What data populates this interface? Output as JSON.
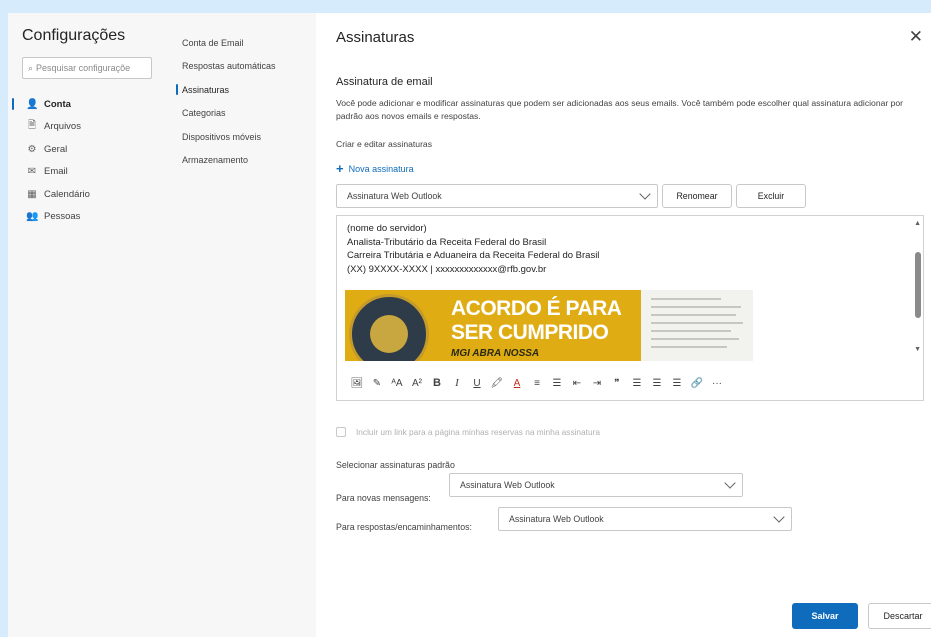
{
  "app": {
    "title": "Configurações"
  },
  "search": {
    "placeholder": "Pesquisar configuraçõe"
  },
  "nav": [
    {
      "label": "Conta",
      "icon": "person-icon",
      "active": true
    },
    {
      "label": "Arquivos",
      "icon": "document-icon",
      "active": false
    },
    {
      "label": "Geral",
      "icon": "gear-icon",
      "active": false
    },
    {
      "label": "Email",
      "icon": "mail-icon",
      "active": false
    },
    {
      "label": "Calendário",
      "icon": "calendar-icon",
      "active": false
    },
    {
      "label": "Pessoas",
      "icon": "people-icon",
      "active": false
    }
  ],
  "subnav": [
    {
      "label": "Conta de Email",
      "active": false
    },
    {
      "label": "Respostas automáticas",
      "active": false
    },
    {
      "label": "Assinaturas",
      "active": true
    },
    {
      "label": "Categorias",
      "active": false
    },
    {
      "label": "Dispositivos móveis",
      "active": false
    },
    {
      "label": "Armazenamento",
      "active": false
    }
  ],
  "main": {
    "title": "Assinaturas",
    "section_title": "Assinatura de email",
    "description": "Você pode adicionar e modificar assinaturas que podem ser adicionadas aos seus emails. Você também pode escolher qual assinatura adicionar por padrão aos novos emails e respostas.",
    "create_label": "Criar e editar assinaturas",
    "new_signature": "Nova assinatura",
    "signature_select": "Assinatura Web Outlook",
    "rename_button": "Renomear",
    "delete_button": "Excluir",
    "signature_lines": [
      "(nome do servidor)",
      "Analista-Tributário da Receita Federal do Brasil",
      "Carreira Tributária e Aduaneira da Receita Federal do Brasil",
      "(XX) 9XXXX-XXXX | xxxxxxxxxxxxx@rfb.gov.br"
    ],
    "banner": {
      "line1": "ACORDO É PARA",
      "line2": "SER CUMPRIDO",
      "line3": "MGI ABRA NOSSA"
    },
    "toolbar": [
      "🖼",
      "✎",
      "ᴬA",
      "A²",
      "B",
      "I",
      "U",
      "🖍",
      "A",
      "≡",
      "☰",
      "⇤",
      "⇥",
      "❞",
      "☰",
      "☰",
      "☰",
      "🔗",
      "···"
    ],
    "checkbox_label": "Incluir um link para a página minhas reservas na minha assinatura",
    "defaults_title": "Selecionar assinaturas padrão",
    "new_messages_label": "Para novas mensagens:",
    "new_messages_value": "Assinatura Web Outlook",
    "replies_label": "Para respostas/encaminhamentos:",
    "replies_value": "Assinatura Web Outlook",
    "save_button": "Salvar",
    "discard_button": "Descartar"
  },
  "colors": {
    "accent": "#0f6cbd",
    "banner_yellow": "#e0ac14",
    "background": "#d6ebfb"
  }
}
